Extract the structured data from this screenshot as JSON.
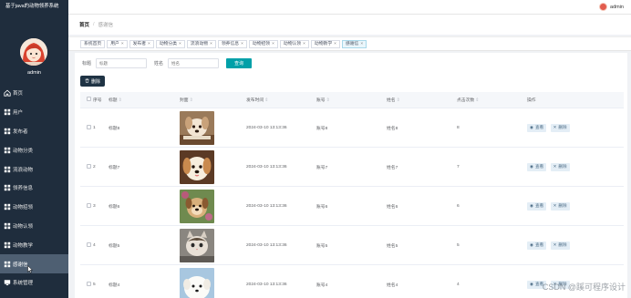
{
  "app": {
    "title": "基于java的动物领养系统"
  },
  "user": {
    "name": "admin",
    "top_name": "admin"
  },
  "sidebar": {
    "items": [
      {
        "label": "首页",
        "icon": "home-icon",
        "active": false
      },
      {
        "label": "用户",
        "icon": "grid-icon",
        "active": false
      },
      {
        "label": "发布者",
        "icon": "grid-icon",
        "active": false
      },
      {
        "label": "动物分类",
        "icon": "grid-icon",
        "active": false
      },
      {
        "label": "流浪动物",
        "icon": "grid-icon",
        "active": false
      },
      {
        "label": "领养信息",
        "icon": "grid-icon",
        "active": false
      },
      {
        "label": "动物招领",
        "icon": "grid-icon",
        "active": false
      },
      {
        "label": "动物认领",
        "icon": "grid-icon",
        "active": false
      },
      {
        "label": "动物教学",
        "icon": "grid-icon",
        "active": false
      },
      {
        "label": "感谢信",
        "icon": "grid-icon",
        "active": true
      },
      {
        "label": "系统管理",
        "icon": "monitor-icon",
        "active": false
      }
    ]
  },
  "breadcrumb": {
    "home": "首页",
    "separator": "/",
    "current": "感谢信"
  },
  "tabs": [
    {
      "label": "系统首页",
      "closable": false,
      "active": false
    },
    {
      "label": "用户",
      "closable": true,
      "active": false
    },
    {
      "label": "发布者",
      "closable": true,
      "active": false
    },
    {
      "label": "动物分类",
      "closable": true,
      "active": false
    },
    {
      "label": "流浪动物",
      "closable": true,
      "active": false
    },
    {
      "label": "领养信息",
      "closable": true,
      "active": false
    },
    {
      "label": "动物招领",
      "closable": true,
      "active": false
    },
    {
      "label": "动物认领",
      "closable": true,
      "active": false
    },
    {
      "label": "动物教学",
      "closable": true,
      "active": false
    },
    {
      "label": "感谢信",
      "closable": true,
      "active": true
    }
  ],
  "tab_close": "×",
  "search": {
    "title_label": "标题",
    "title_placeholder": "标题",
    "name_label": "姓名",
    "name_placeholder": "姓名",
    "button": "查询"
  },
  "delete_button": "删除",
  "table": {
    "headers": {
      "index": "序号",
      "title": "标题",
      "image": "封面",
      "time": "发布时间",
      "account": "账号",
      "name": "姓名",
      "clicks": "点击次数",
      "ops": "操作"
    },
    "sort_mark": "⇕",
    "view_label": "查看",
    "delete_label": "删除",
    "rows": [
      {
        "index": "1",
        "title": "标题8",
        "time": "2024-03-10 13:13:36",
        "account": "账号8",
        "name": "姓名8",
        "clicks": "8",
        "pet": "puppy-peek"
      },
      {
        "index": "2",
        "title": "标题7",
        "time": "2024-03-10 13:13:36",
        "account": "账号7",
        "name": "姓名7",
        "clicks": "7",
        "pet": "golden-puppy"
      },
      {
        "index": "3",
        "title": "标题6",
        "time": "2024-03-10 13:13:36",
        "account": "账号6",
        "name": "姓名6",
        "clicks": "6",
        "pet": "puppy-garden"
      },
      {
        "index": "4",
        "title": "标题5",
        "time": "2024-03-10 13:13:36",
        "account": "账号5",
        "name": "姓名5",
        "clicks": "5",
        "pet": "cat"
      },
      {
        "index": "5",
        "title": "标题4",
        "time": "2024-03-10 13:13:36",
        "account": "账号4",
        "name": "姓名4",
        "clicks": "4",
        "pet": "white-dog"
      }
    ]
  },
  "watermark": "CSDN @蹊可程序设计",
  "colors": {
    "sidebar_bg": "#1f2d3d",
    "accent": "#00a0a8",
    "delete_btn": "#1f3344",
    "active_menu": "#4e5f72"
  }
}
